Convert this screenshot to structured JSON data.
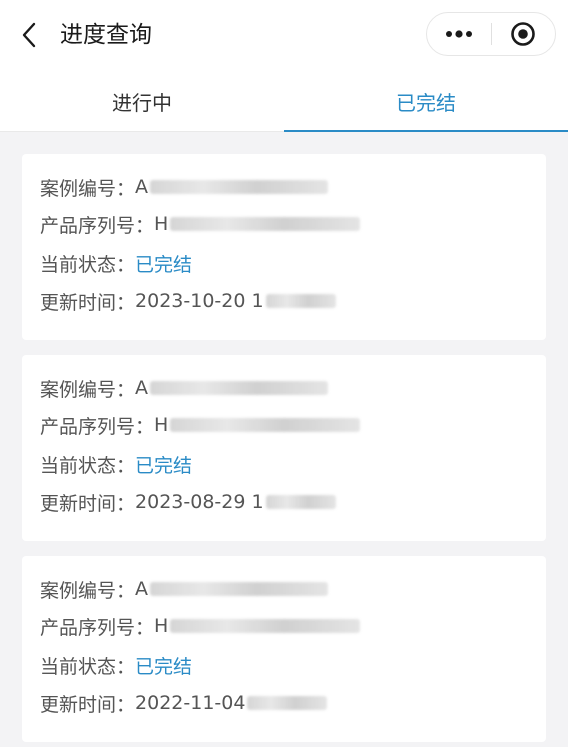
{
  "header": {
    "title": "进度查询",
    "back_icon": "chevron-left-icon",
    "more_icon": "more-dots-icon",
    "close_icon": "target-icon"
  },
  "tabs": [
    {
      "label": "进行中",
      "active": false
    },
    {
      "label": "已完结",
      "active": true
    }
  ],
  "accent_color": "#2a8bc6",
  "labels": {
    "case_no": "案例编号：",
    "serial_no": "产品序列号：",
    "status": "当前状态：",
    "updated": "更新时间："
  },
  "cards": [
    {
      "case_prefix": "A",
      "serial_prefix": "H",
      "status": "已完结",
      "updated": "2023-10-20 1"
    },
    {
      "case_prefix": "A",
      "serial_prefix": "H",
      "status": "已完结",
      "updated": "2023-08-29 1"
    },
    {
      "case_prefix": "A",
      "serial_prefix": "H",
      "status": "已完结",
      "updated": "2022-11-04"
    }
  ]
}
